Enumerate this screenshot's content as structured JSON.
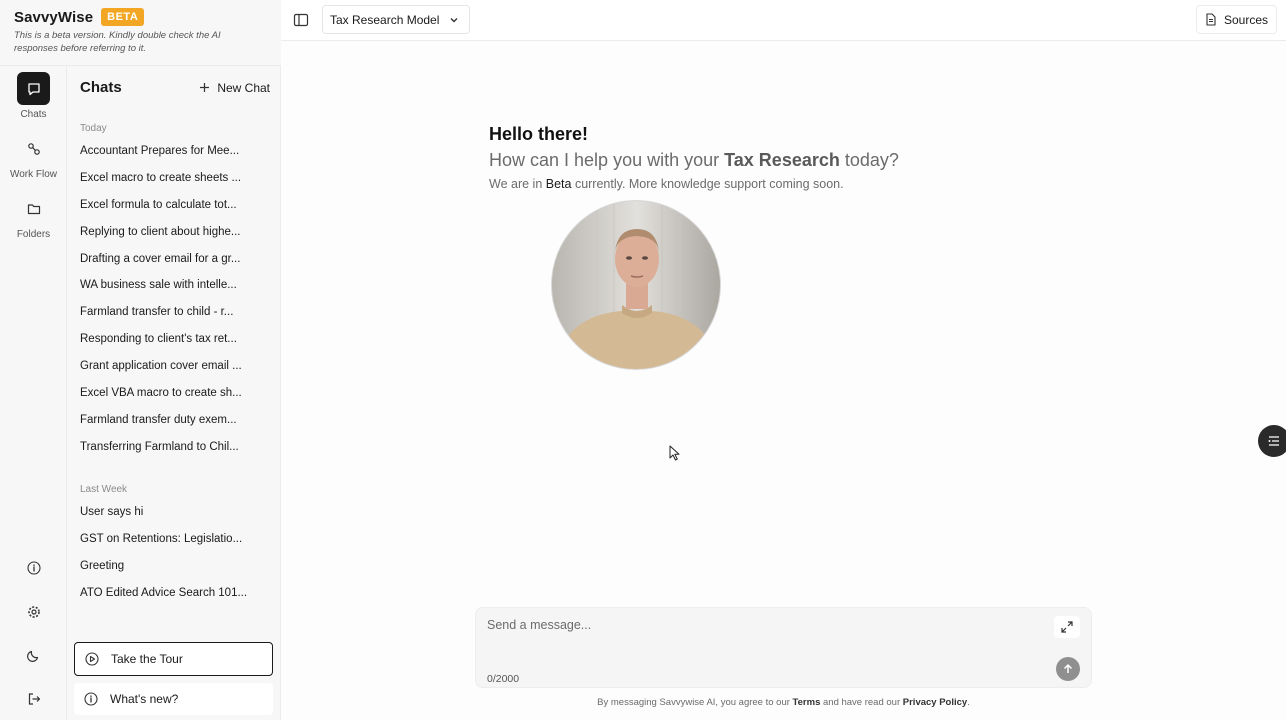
{
  "brand": {
    "name": "SavvyWise",
    "badge": "BETA",
    "note": "This is a beta version. Kindly double check the AI responses before referring to it.",
    "badge_color": "#f2a623"
  },
  "rail": {
    "items": [
      {
        "label": "Chats",
        "icon": "chat-icon",
        "active": true
      },
      {
        "label": "Work Flow",
        "icon": "workflow-icon"
      },
      {
        "label": "Folders",
        "icon": "folder-icon"
      }
    ],
    "bottom_icons": [
      "info-icon",
      "settings-icon",
      "moon-icon",
      "logout-icon"
    ]
  },
  "chats": {
    "title": "Chats",
    "new_chat": "New Chat",
    "today_label": "Today",
    "today": [
      "Accountant Prepares for Mee...",
      "Excel macro to create sheets ...",
      "Excel formula to calculate tot...",
      "Replying to client about highe...",
      "Drafting a cover email for a gr...",
      "WA business sale with intelle...",
      "Farmland transfer to child - r...",
      "Responding to client's tax ret...",
      "Grant application cover email ...",
      "Excel VBA macro to create sh...",
      "Farmland transfer duty exem...",
      "Transferring Farmland to Chil..."
    ],
    "last_week_label": "Last Week",
    "last_week": [
      "User says hi",
      "GST on Retentions: Legislatio...",
      "Greeting",
      "ATO Edited Advice Search 101..."
    ],
    "tour": "Take the Tour",
    "whats_new": "What's new?"
  },
  "topbar": {
    "model": "Tax Research Model",
    "sources": "Sources"
  },
  "main": {
    "hello": "Hello there!",
    "sub_pre": "How can I help you with your ",
    "sub_bold": "Tax Research",
    "sub_post": " today?",
    "note_pre": "We are in ",
    "note_bold": "Beta",
    "note_post": " currently. More knowledge support coming soon."
  },
  "composer": {
    "placeholder": "Send a message...",
    "counter": "0/2000"
  },
  "footer": {
    "pre": "By messaging Savvywise AI, you agree to our ",
    "terms": "Terms",
    "mid": " and have read our ",
    "privacy": "Privacy Policy",
    "post": "."
  }
}
